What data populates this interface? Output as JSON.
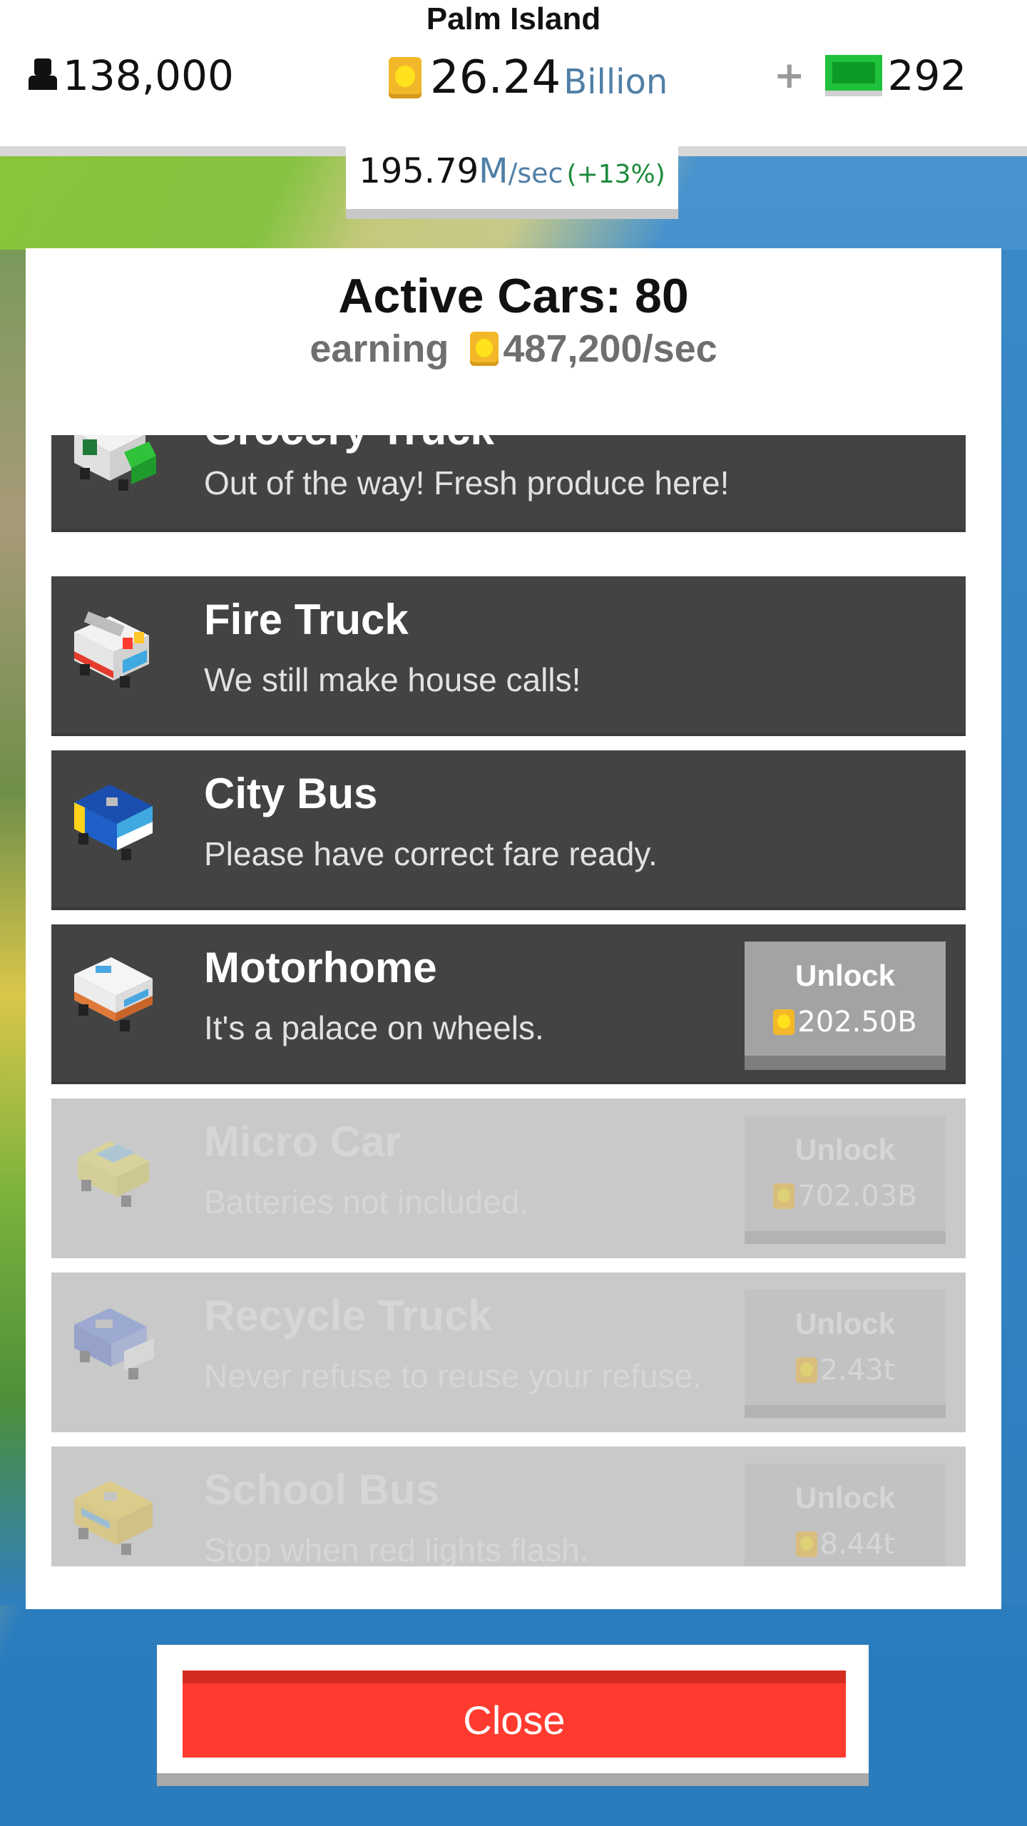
{
  "hud": {
    "island_name": "Palm Island",
    "population": "138,000",
    "cash_value": "26.24",
    "cash_unit": "Billion",
    "gem_plus": "+",
    "gems": "292",
    "rate_value": "195.79",
    "rate_unit": "M",
    "rate_per": "/sec",
    "rate_bonus": "(+13%)"
  },
  "modal": {
    "title": "Active Cars: 80",
    "earning_label": "earning",
    "earning_value": "487,200/sec",
    "cars": [
      {
        "name": "Grocery Truck",
        "desc": "Out of the way! Fresh produce here!",
        "unlocked": true
      },
      {
        "name": "Fire Truck",
        "desc": "We still make house calls!",
        "unlocked": true
      },
      {
        "name": "City Bus",
        "desc": "Please have correct fare ready.",
        "unlocked": true
      },
      {
        "name": "Motorhome",
        "desc": "It's a palace on wheels.",
        "unlock_label": "Unlock",
        "price": "202.50B"
      },
      {
        "name": "Micro Car",
        "desc": "Batteries not included.",
        "unlock_label": "Unlock",
        "price": "702.03B"
      },
      {
        "name": "Recycle Truck",
        "desc": "Never refuse to reuse your refuse.",
        "unlock_label": "Unlock",
        "price": "2.43t"
      },
      {
        "name": "School Bus",
        "desc": "Stop when red lights flash.",
        "unlock_label": "Unlock",
        "price": "8.44t"
      }
    ],
    "close_label": "Close"
  },
  "colors": {
    "accent_red": "#ff3b2f",
    "row_dark": "#434343",
    "row_locked": "#c9c9c9",
    "coin": "#f3b829",
    "gem": "#1fc23a",
    "rate_unit": "#4f7fa6",
    "rate_bonus": "#1d8a3c"
  }
}
